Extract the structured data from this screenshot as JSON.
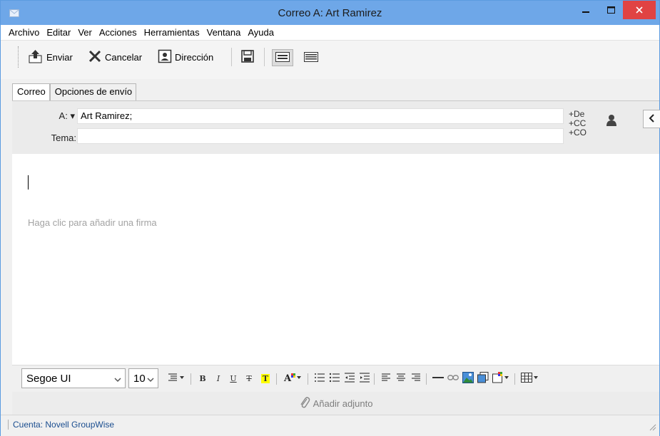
{
  "window": {
    "title": "Correo A: Art Ramirez",
    "minimize_icon": "minimize-icon",
    "maximize_icon": "maximize-icon",
    "close_icon": "close-icon",
    "close_color": "#e04343",
    "titlebar_color": "#6ea7e8"
  },
  "menu": {
    "items": [
      "Archivo",
      "Editar",
      "Ver",
      "Acciones",
      "Herramientas",
      "Ventana",
      "Ayuda"
    ]
  },
  "toolbar": {
    "send": {
      "label": "Enviar",
      "icon": "send-icon"
    },
    "cancel": {
      "label": "Cancelar",
      "icon": "close-x-icon"
    },
    "address": {
      "label": "Dirección",
      "icon": "address-book-icon"
    },
    "save_icon": "save-icon",
    "view_icons": [
      "html-view-icon",
      "plain-text-view-icon"
    ]
  },
  "tabs": [
    {
      "label": "Correo",
      "active": true
    },
    {
      "label": "Opciones de envío",
      "active": false
    }
  ],
  "addressing": {
    "to_label": "A:",
    "to_value": "Art Ramirez;",
    "subject_label": "Tema:",
    "subject_value": "",
    "links": [
      "+De",
      "+CC",
      "+CO"
    ],
    "contact_icon": "person-icon",
    "collapse_icon": "chevron-left-icon"
  },
  "compose": {
    "signature_placeholder": "Haga clic para añadir una firma"
  },
  "format": {
    "font": "Segoe UI",
    "size": "10",
    "buttons": [
      "paragraph-style-icon",
      "bold-icon",
      "italic-icon",
      "underline-icon",
      "strikethrough-icon",
      "highlight-icon",
      "font-color-icon",
      "numbered-list-icon",
      "bulleted-list-icon",
      "decrease-indent-icon",
      "increase-indent-icon",
      "align-left-icon",
      "align-center-icon",
      "align-right-icon",
      "horizontal-line-icon",
      "link-icon",
      "insert-image-icon",
      "insert-object-icon",
      "background-color-icon",
      "table-icon"
    ],
    "highlight_color": "#ffff00"
  },
  "attachment": {
    "label": "Añadir adjunto",
    "icon": "paperclip-icon"
  },
  "status": {
    "account": "Cuenta: Novell GroupWise"
  }
}
